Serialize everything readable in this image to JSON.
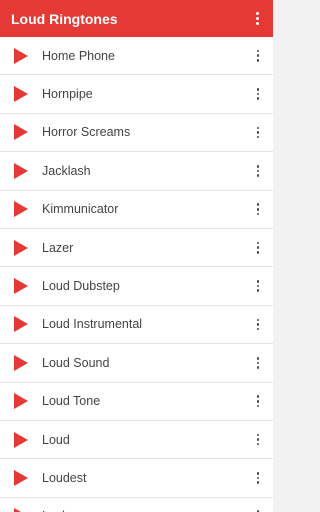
{
  "colors": {
    "app_bar": "#e53935",
    "play_icon": "#e53935",
    "row_background": "#ffffff",
    "divider": "#e3e3e3",
    "text": "#444444"
  },
  "app_bar": {
    "title": "Loud Ringtones",
    "overflow_icon": "more-vert-icon"
  },
  "list": {
    "play_icon": "play-icon",
    "menu_icon": "more-vert-icon",
    "items": [
      {
        "label": "Home Phone"
      },
      {
        "label": "Hornpipe"
      },
      {
        "label": "Horror Screams"
      },
      {
        "label": "Jacklash"
      },
      {
        "label": "Kimmunicator"
      },
      {
        "label": "Lazer"
      },
      {
        "label": "Loud Dubstep"
      },
      {
        "label": "Loud Instrumental"
      },
      {
        "label": "Loud Sound"
      },
      {
        "label": "Loud Tone"
      },
      {
        "label": "Loud"
      },
      {
        "label": "Loudest"
      },
      {
        "label": "Lucky"
      }
    ]
  }
}
